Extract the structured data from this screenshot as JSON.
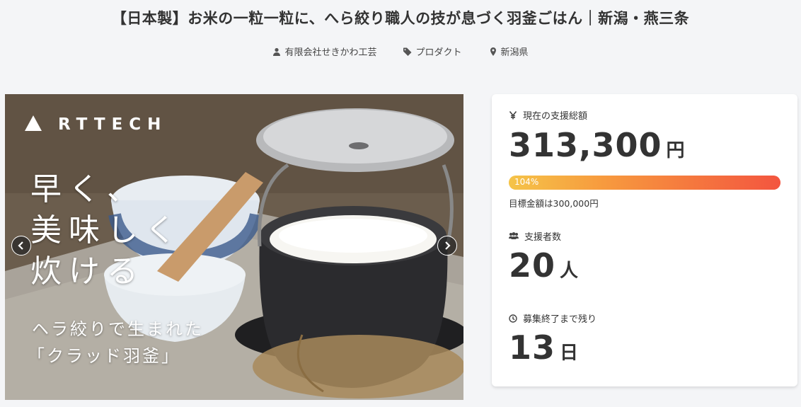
{
  "project": {
    "title": "【日本製】お米の一粒一粒に、へら絞り職人の技が息づく羽釜ごはん｜新潟・燕三条",
    "owner": "有限会社せきかわ工芸",
    "category": "プロダクト",
    "location": "新潟県"
  },
  "hero": {
    "brand": "RTTECH",
    "catch_lines": [
      "早く、",
      "美味しく",
      "炊ける"
    ],
    "sub_line1": "ヘラ絞りで生まれた",
    "sub_line2": "「クラッド羽釜」"
  },
  "funding": {
    "total_label": "現在の支援総額",
    "total_amount": "313,300",
    "currency_unit": "円",
    "progress_percent": 104,
    "progress_label": "104%",
    "goal_text": "目標金額は300,000円",
    "supporters_label": "支援者数",
    "supporters_count": "20",
    "supporters_unit": "人",
    "remaining_label": "募集終了まで残り",
    "remaining_days": "13",
    "remaining_unit": "日"
  },
  "icons": {
    "owner": "person-icon",
    "category": "tag-icon",
    "location": "map-pin-icon",
    "yen": "yen-icon",
    "supporters": "users-icon",
    "remaining": "clock-icon"
  },
  "colors": {
    "progress_start": "#f5c449",
    "progress_end": "#f3553f",
    "text": "#333333",
    "background": "#f4f5f7"
  }
}
